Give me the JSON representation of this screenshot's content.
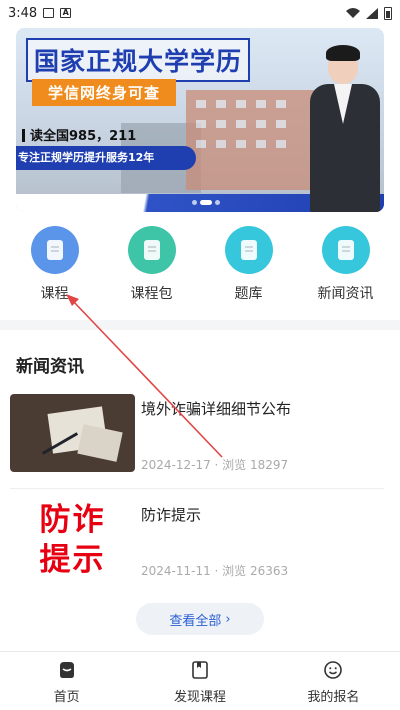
{
  "status_bar": {
    "time": "3:48",
    "icons": [
      "image-icon",
      "a-icon",
      "wifi-icon",
      "signal-icon",
      "battery-icon"
    ]
  },
  "banner": {
    "title": "国家正规大学学历",
    "tag": "学信网终身可查",
    "line1": "读全国985，211",
    "line2": "专注正规学历提升服务12年",
    "active_slide": 1,
    "slide_count": 3
  },
  "categories": [
    {
      "label": "课程",
      "icon": "course-icon",
      "color": "#5b95ea"
    },
    {
      "label": "课程包",
      "icon": "package-icon",
      "color": "#3ec4a7"
    },
    {
      "label": "题库",
      "icon": "question-bank-icon",
      "color": "#36c7dc"
    },
    {
      "label": "新闻资讯",
      "icon": "news-icon",
      "color": "#36c7dc"
    }
  ],
  "news": {
    "section_title": "新闻资讯",
    "items": [
      {
        "title": "境外诈骗详细细节公布",
        "meta": "2024-12-17 · 浏览 18297"
      },
      {
        "title": "防诈提示",
        "thumb_text": [
          "防诈",
          "提示"
        ],
        "meta": "2024-11-11 · 浏览 26363"
      }
    ],
    "view_all": "查看全部",
    "view_all_arrow": "›"
  },
  "tabbar": [
    {
      "label": "首页",
      "icon": "home-icon"
    },
    {
      "label": "发现课程",
      "icon": "discover-icon"
    },
    {
      "label": "我的报名",
      "icon": "profile-icon"
    }
  ],
  "colors": {
    "accent": "#2a5fd4",
    "annotation": "#e24545",
    "banner_blue": "#1f3fb0",
    "banner_orange": "#f08c1e"
  }
}
